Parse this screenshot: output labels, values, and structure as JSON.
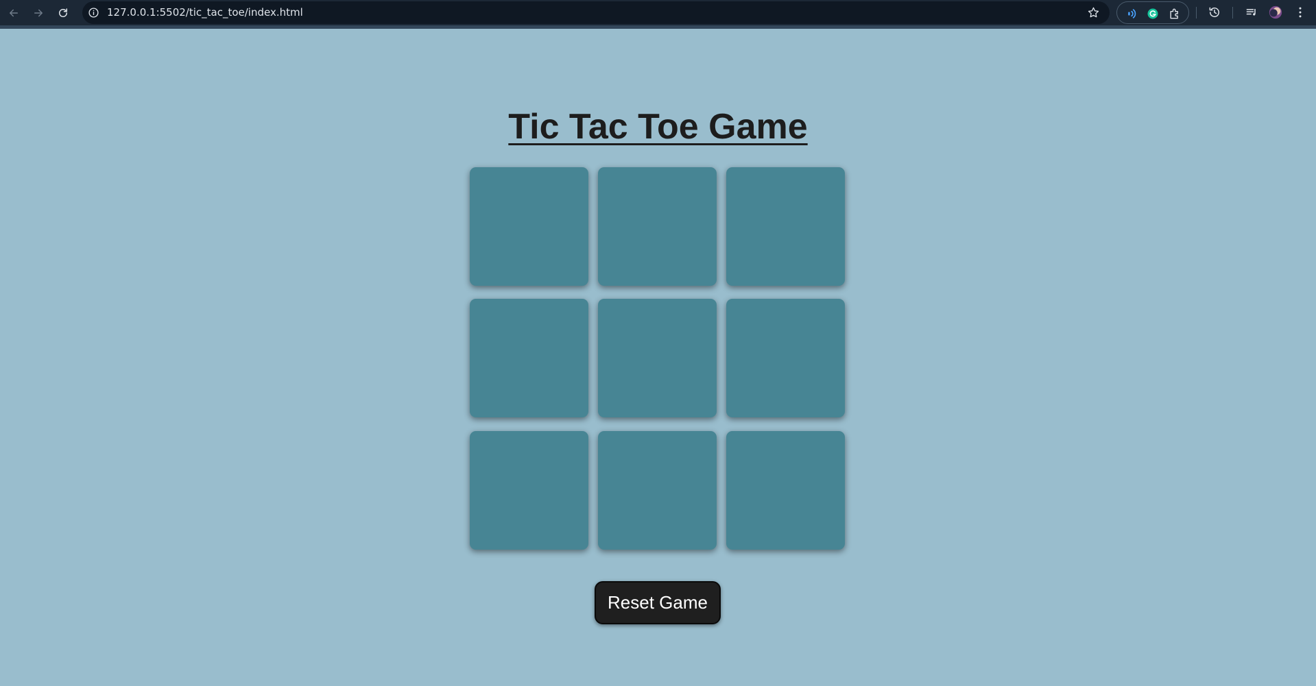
{
  "browser": {
    "url": "127.0.0.1:5502/tic_tac_toe/index.html",
    "icons": {
      "back": "back-arrow-icon",
      "forward": "forward-arrow-icon",
      "reload": "reload-icon",
      "site_info": "info-icon",
      "bookmark": "star-icon",
      "read_aloud": "read-aloud-icon",
      "grammarly": "grammarly-icon",
      "extensions": "puzzle-icon",
      "history": "history-icon",
      "media": "media-control-icon",
      "profile": "avatar",
      "menu": "kebab-menu-icon"
    },
    "colors": {
      "toolbar": "#1c2836",
      "omnibox": "#0f1823",
      "accent": "#4aa3ff",
      "grammarly": "#15c39a"
    }
  },
  "game": {
    "title": "Tic Tac Toe Game",
    "cells": [
      "",
      "",
      "",
      "",
      "",
      "",
      "",
      "",
      ""
    ],
    "reset_label": "Reset Game",
    "colors": {
      "background": "#99bdcd",
      "cell": "#478594",
      "button": "#1f1f1f",
      "title": "#1d1d1d"
    }
  }
}
